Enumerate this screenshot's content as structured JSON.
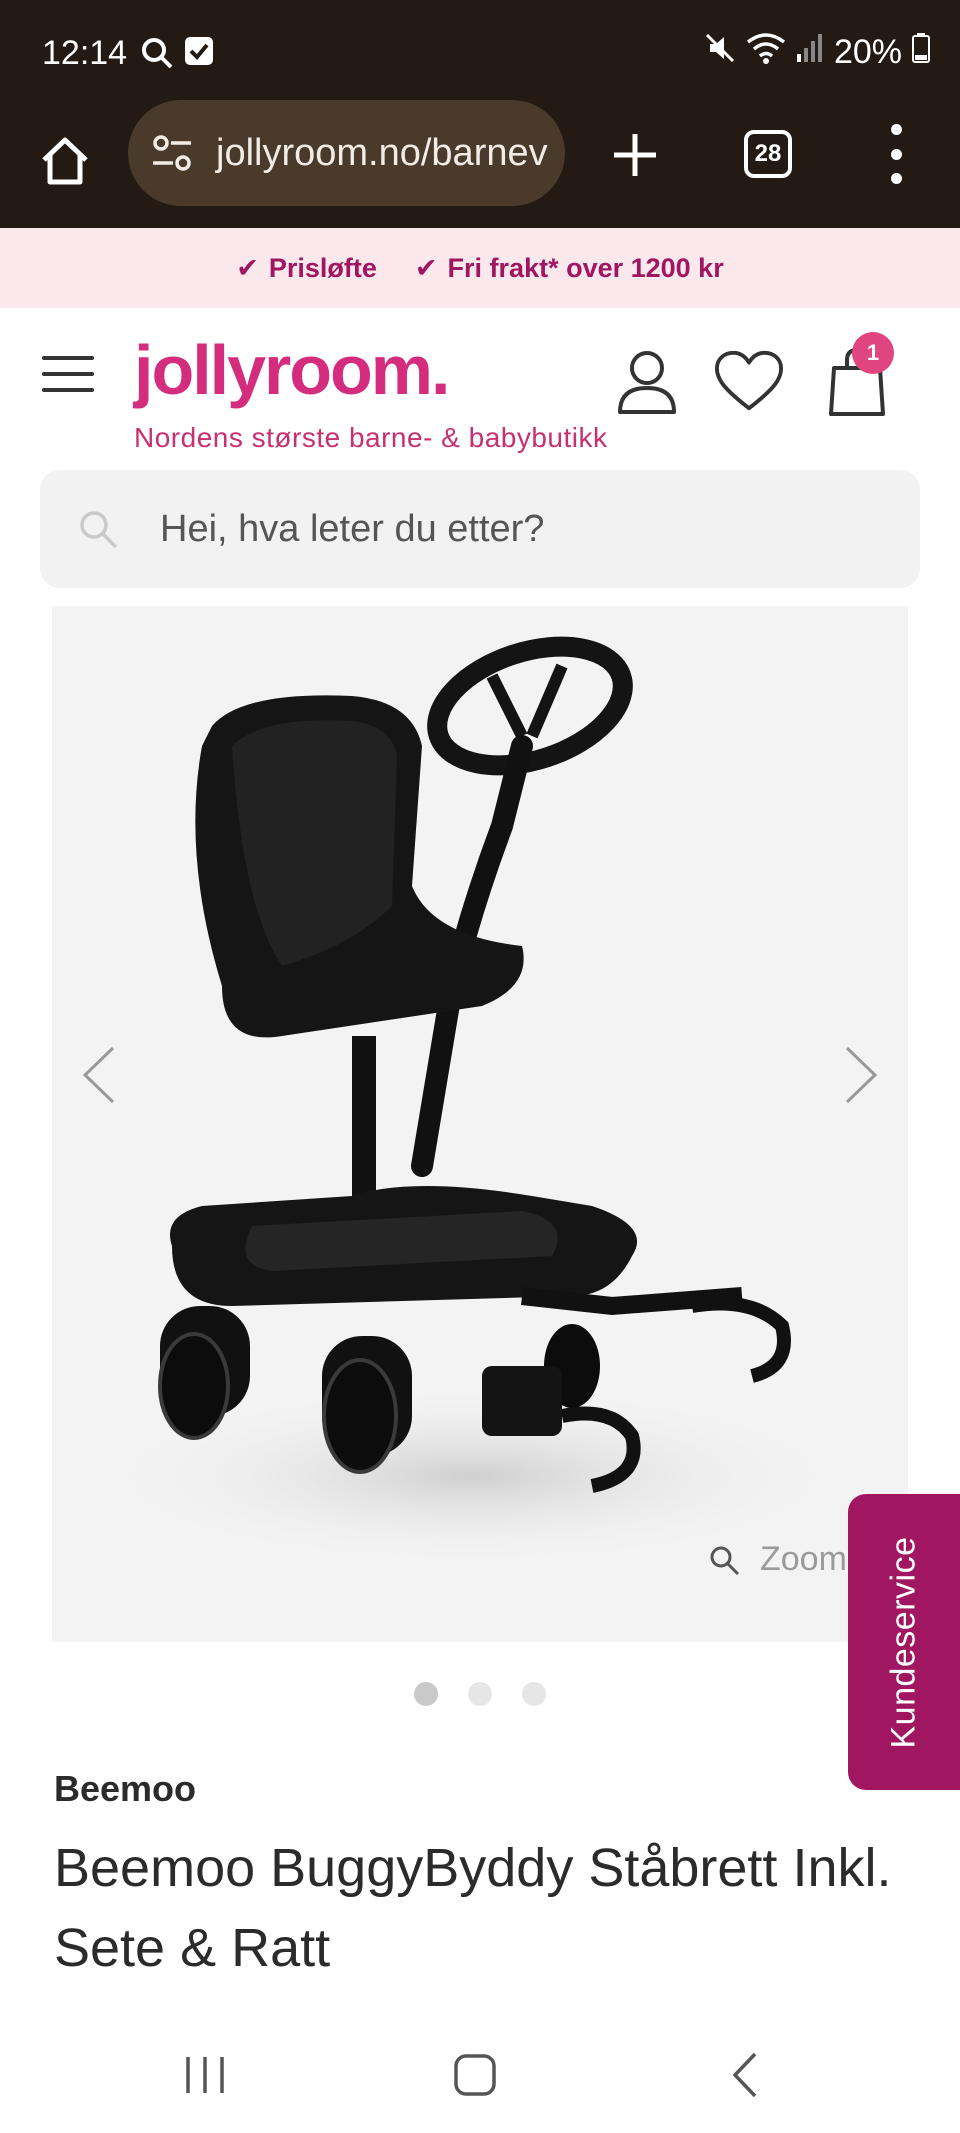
{
  "status_bar": {
    "time": "12:14",
    "battery": "20%"
  },
  "browser": {
    "url": "jollyroom.no/barnev",
    "tab_count": "28"
  },
  "promo": {
    "items": [
      "Prisløfte",
      "Fri frakt* over 1200 kr"
    ]
  },
  "header": {
    "logo": "jollyroom.",
    "tagline": "Nordens største barne- & babybutikk",
    "cart_count": "1"
  },
  "search": {
    "placeholder": "Hei, hva leter du etter?"
  },
  "gallery": {
    "zoom_label": "Zoom",
    "slide_count": 3,
    "active_slide": 1
  },
  "customer_service": {
    "label": "Kundeservice"
  },
  "product": {
    "brand": "Beemoo",
    "title": "Beemoo BuggyByddy Ståbrett Inkl. Sete & Ratt"
  },
  "colors": {
    "chrome": "#231a14",
    "brand_pink": "#d52d7e",
    "brand_plum": "#a11660",
    "promo_bg": "#fbe8ec"
  }
}
